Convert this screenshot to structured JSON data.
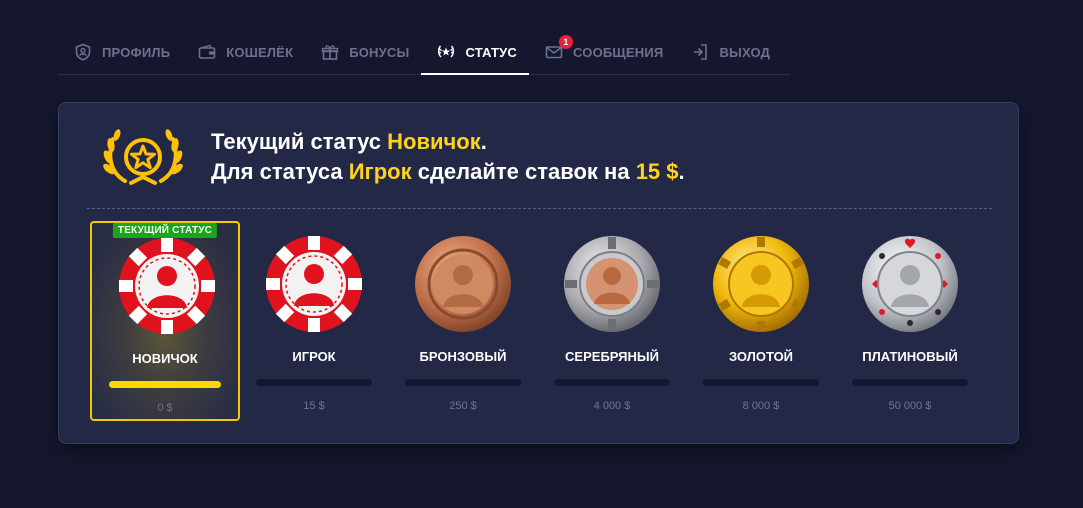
{
  "tabs": [
    {
      "label": "ПРОФИЛЬ",
      "icon": "shield-icon",
      "active": false
    },
    {
      "label": "КОШЕЛЁК",
      "icon": "wallet-icon",
      "active": false
    },
    {
      "label": "БОНУСЫ",
      "icon": "gift-icon",
      "active": false
    },
    {
      "label": "СТАТУС",
      "icon": "laurel-icon",
      "active": true
    },
    {
      "label": "СООБЩЕНИЯ",
      "icon": "envelope-icon",
      "active": false,
      "badge": "1"
    },
    {
      "label": "ВЫХОД",
      "icon": "exit-icon",
      "active": false
    }
  ],
  "status": {
    "line1_prefix": "Текущий статус ",
    "current_status": "Новичок",
    "line1_suffix": ".",
    "line2_prefix": "Для статуса ",
    "next_status": "Игрок",
    "line2_middle": " сделайте ставок на ",
    "amount_needed": "15 $",
    "line2_suffix": "."
  },
  "current_badge": "ТЕКУЩИЙ СТАТУС",
  "colors": {
    "background": "#15172e",
    "panel": "#222845",
    "accent_yellow": "#ffd21f",
    "badge_green": "#1aa51a",
    "notification_red": "#e8223a"
  },
  "levels": [
    {
      "name": "НОВИЧОК",
      "amount": "0 $",
      "progress": 1.0,
      "current": true,
      "chip": "red-white"
    },
    {
      "name": "ИГРОК",
      "amount": "15 $",
      "progress": 0.0,
      "current": false,
      "chip": "red-white"
    },
    {
      "name": "БРОНЗОВЫЙ",
      "amount": "250 $",
      "progress": 0.0,
      "current": false,
      "chip": "bronze"
    },
    {
      "name": "СЕРЕБРЯНЫЙ",
      "amount": "4 000 $",
      "progress": 0.0,
      "current": false,
      "chip": "silver"
    },
    {
      "name": "ЗОЛОТОЙ",
      "amount": "8 000 $",
      "progress": 0.0,
      "current": false,
      "chip": "gold"
    },
    {
      "name": "ПЛАТИНОВЫЙ",
      "amount": "50 000 $",
      "progress": 0.0,
      "current": false,
      "chip": "platinum"
    }
  ]
}
